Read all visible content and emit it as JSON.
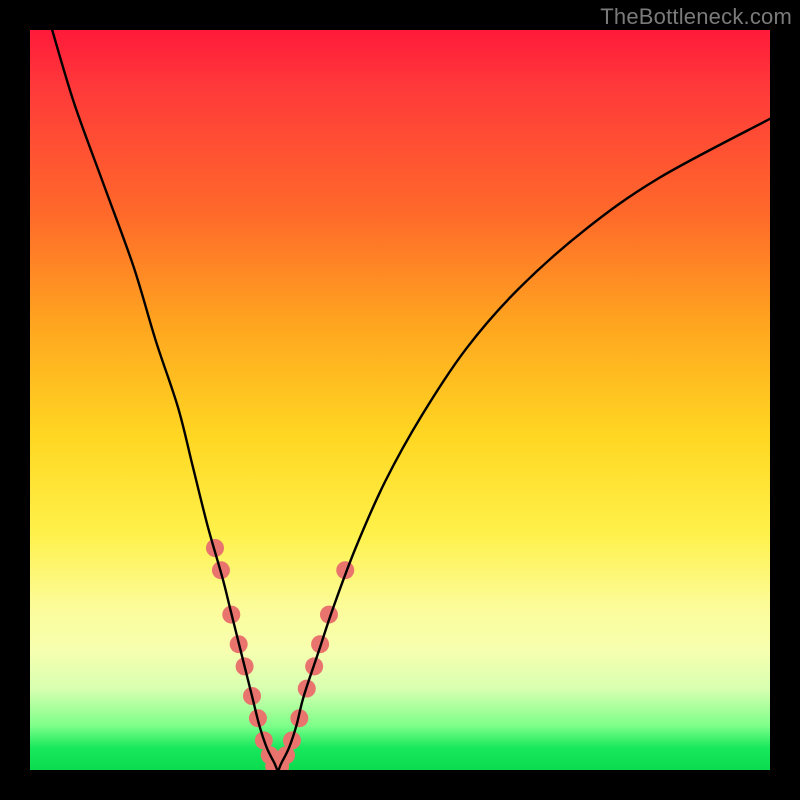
{
  "watermark": "TheBottleneck.com",
  "chart_data": {
    "type": "line",
    "title": "",
    "xlabel": "",
    "ylabel": "",
    "xlim": [
      0,
      100
    ],
    "ylim": [
      0,
      100
    ],
    "series": [
      {
        "name": "bottleneck-curve",
        "x": [
          3,
          6,
          10,
          14,
          17,
          20,
          22,
          24,
          26,
          27,
          28,
          29,
          30,
          31,
          32,
          33,
          33.5,
          34,
          35,
          36,
          37,
          39,
          41,
          44,
          48,
          53,
          59,
          66,
          75,
          85,
          100
        ],
        "values": [
          100,
          90,
          79,
          68,
          58,
          49,
          41,
          33,
          26,
          22,
          18,
          14,
          10,
          6,
          3,
          1,
          0,
          1,
          3,
          6,
          10,
          16,
          22,
          30,
          39,
          48,
          57,
          65,
          73,
          80,
          88
        ]
      }
    ],
    "markers": {
      "name": "highlight-dots",
      "color": "#e9746e",
      "points": [
        {
          "x": 25.0,
          "y": 30
        },
        {
          "x": 25.8,
          "y": 27
        },
        {
          "x": 27.2,
          "y": 21
        },
        {
          "x": 28.2,
          "y": 17
        },
        {
          "x": 29.0,
          "y": 14
        },
        {
          "x": 30.0,
          "y": 10
        },
        {
          "x": 30.8,
          "y": 7
        },
        {
          "x": 31.6,
          "y": 4
        },
        {
          "x": 32.4,
          "y": 2
        },
        {
          "x": 33.0,
          "y": 0.5
        },
        {
          "x": 33.8,
          "y": 0.5
        },
        {
          "x": 34.6,
          "y": 2
        },
        {
          "x": 35.4,
          "y": 4
        },
        {
          "x": 36.4,
          "y": 7
        },
        {
          "x": 37.4,
          "y": 11
        },
        {
          "x": 38.4,
          "y": 14
        },
        {
          "x": 39.2,
          "y": 17
        },
        {
          "x": 40.4,
          "y": 21
        },
        {
          "x": 42.6,
          "y": 27
        }
      ]
    },
    "background_gradient": {
      "top": "#ff1a3a",
      "mid_high": "#ffa61f",
      "mid": "#fff14a",
      "mid_low": "#f6ffb0",
      "bottom": "#0bdc4e"
    }
  }
}
